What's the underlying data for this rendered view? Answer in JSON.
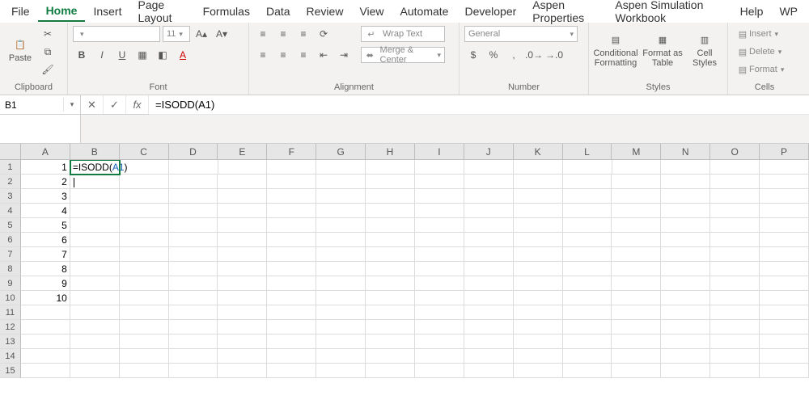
{
  "tabs": [
    "File",
    "Home",
    "Insert",
    "Page Layout",
    "Formulas",
    "Data",
    "Review",
    "View",
    "Automate",
    "Developer",
    "Aspen Properties",
    "Aspen Simulation Workbook",
    "Help",
    "WP"
  ],
  "activeTab": "Home",
  "ribbon": {
    "clipboard": {
      "title": "Clipboard",
      "paste": "Paste"
    },
    "font": {
      "title": "Font",
      "fontName": "",
      "fontSize": "11",
      "btns": {
        "bold": "B",
        "italic": "I",
        "underline": "U",
        "incSize": "A▴",
        "decSize": "A▾"
      }
    },
    "alignment": {
      "title": "Alignment",
      "wrap": "Wrap Text",
      "merge": "Merge & Center"
    },
    "number": {
      "title": "Number",
      "format": "General",
      "currency": "$",
      "percent": "%",
      "comma": ","
    },
    "styles": {
      "title": "Styles",
      "cond": "Conditional\nFormatting",
      "table": "Format as\nTable",
      "cell": "Cell\nStyles"
    },
    "cells": {
      "title": "Cells",
      "insert": "Insert",
      "delete": "Delete",
      "format": "Format"
    }
  },
  "formulaBar": {
    "nameBox": "B1",
    "cancel": "✕",
    "accept": "✓",
    "fx": "fx",
    "entry": "=ISODD(A1)"
  },
  "columns": [
    "A",
    "B",
    "C",
    "D",
    "E",
    "F",
    "G",
    "H",
    "I",
    "J",
    "K",
    "L",
    "M",
    "N",
    "O",
    "P"
  ],
  "rows": 15,
  "colA": {
    "1": "1",
    "2": "2",
    "3": "3",
    "4": "4",
    "5": "5",
    "6": "6",
    "7": "7",
    "8": "8",
    "9": "9",
    "10": "10"
  },
  "activeCell": {
    "row": 1,
    "col": "B",
    "display_prefix": "=ISODD(",
    "display_ref": "A1",
    "display_suffix": ")"
  }
}
